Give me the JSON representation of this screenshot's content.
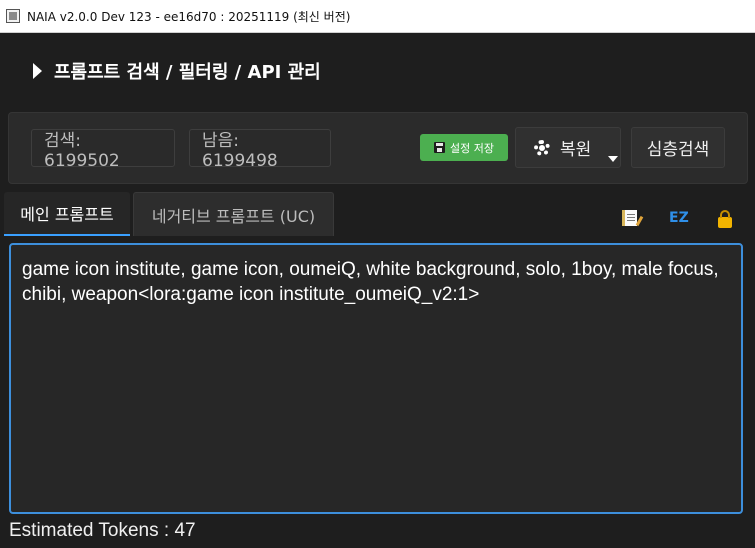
{
  "window": {
    "title": "NAIA v2.0.0 Dev 123 - ee16d70 : 20251119 (최신 버전)"
  },
  "header": {
    "section_title": "프롬프트 검색 / 필터링 / API 관리"
  },
  "stats": {
    "search_count": "검색: 6199502",
    "remaining_count": "남음: 6199498"
  },
  "toolbar": {
    "save_settings_label": "설정 저장",
    "restore_label": "복원",
    "deep_search_label": "심층검색"
  },
  "tabs": [
    {
      "label": "메인 프롬프트",
      "active": true
    },
    {
      "label": "네거티브 프롬프트 (UC)",
      "active": false
    }
  ],
  "tools": {
    "ez_label": "EZ"
  },
  "prompt": {
    "text": "game icon institute, game icon, oumeiQ, white background, solo, 1boy, male focus, chibi, weapon<lora:game icon institute_oumeiQ_v2:1>"
  },
  "footer": {
    "token_estimate": "Estimated Tokens : 47"
  },
  "colors": {
    "accent_blue": "#3d8fdc",
    "save_green": "#4caf50",
    "background": "#1e1e1e"
  }
}
